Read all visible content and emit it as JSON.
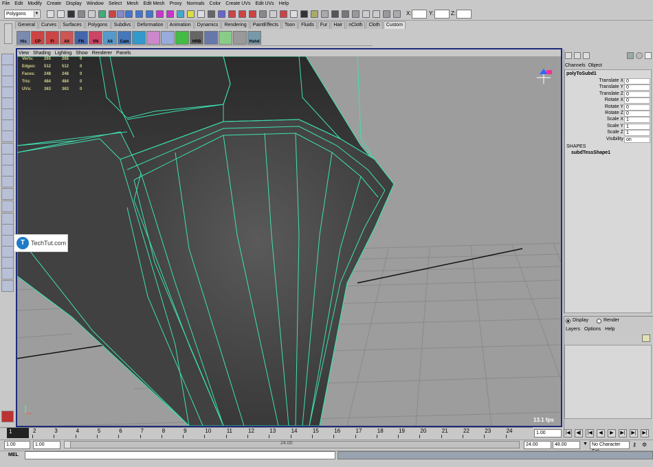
{
  "menubar": [
    "File",
    "Edit",
    "Modify",
    "Create",
    "Display",
    "Window",
    "Select",
    "Mesh",
    "Edit Mesh",
    "Proxy",
    "Normals",
    "Color",
    "Create UVs",
    "Edit UVs",
    "Help"
  ],
  "status_line": {
    "mode": "Polygons",
    "x_label": "X:",
    "y_label": "Y:",
    "z_label": "Z:"
  },
  "shelf_tabs": [
    "General",
    "Curves",
    "Surfaces",
    "Polygons",
    "Subdivs",
    "Deformation",
    "Animation",
    "Dynamics",
    "Rendering",
    "PaintEffects",
    "Toon",
    "Fluids",
    "Fur",
    "Hair",
    "nCloth",
    "Cloth",
    "Custom"
  ],
  "active_shelf_tab": "Custom",
  "shelf_buttons": [
    "His",
    "CP",
    "FI",
    "All",
    "FN",
    "VN",
    "All",
    "Cam",
    "",
    "",
    "",
    "",
    "HRB",
    "",
    "",
    "",
    "Hshd"
  ],
  "viewport_menu": [
    "View",
    "Shading",
    "Lighting",
    "Show",
    "Renderer",
    "Panels"
  ],
  "hud": {
    "rows": [
      {
        "label": "Verts:",
        "a": "265",
        "b": "265",
        "c": "0"
      },
      {
        "label": "Edges:",
        "a": "512",
        "b": "512",
        "c": "0"
      },
      {
        "label": "Faces:",
        "a": "248",
        "b": "248",
        "c": "0"
      },
      {
        "label": "Tris:",
        "a": "484",
        "b": "484",
        "c": "0"
      },
      {
        "label": "UVs:",
        "a": "363",
        "b": "363",
        "c": "0"
      }
    ],
    "fps": "13.1 fps"
  },
  "watermark": {
    "logo": "T",
    "text": "TechTut.com"
  },
  "channel_box": {
    "menu": [
      "Channels",
      "Object"
    ],
    "node": "polyToSubd1",
    "attributes": [
      {
        "name": "Translate X",
        "value": "0"
      },
      {
        "name": "Translate Y",
        "value": "0"
      },
      {
        "name": "Translate Z",
        "value": "0"
      },
      {
        "name": "Rotate X",
        "value": "0"
      },
      {
        "name": "Rotate Y",
        "value": "0"
      },
      {
        "name": "Rotate Z",
        "value": "0"
      },
      {
        "name": "Scale X",
        "value": "1"
      },
      {
        "name": "Scale Y",
        "value": "1"
      },
      {
        "name": "Scale Z",
        "value": "1"
      },
      {
        "name": "Visibility",
        "value": "on"
      }
    ],
    "shapes_label": "SHAPES",
    "shape": "subdTessShape1"
  },
  "layer_editor": {
    "display_label": "Display",
    "render_label": "Render",
    "menu": [
      "Layers",
      "Options",
      "Help"
    ]
  },
  "time_slider": {
    "current_frame": "1",
    "ticks": [
      "2",
      "3",
      "4",
      "5",
      "6",
      "7",
      "8",
      "9",
      "10",
      "11",
      "12",
      "13",
      "14",
      "15",
      "16",
      "17",
      "18",
      "19",
      "20",
      "21",
      "22",
      "23",
      "24"
    ],
    "current_time_field": "1.00"
  },
  "range_slider": {
    "start": "1.00",
    "playback_start": "1.00",
    "range_end_label": "24.00",
    "playback_end": "24.00",
    "end": "48.00",
    "character_set": "No Character Set"
  },
  "command_line": {
    "label": "MEL"
  },
  "colors": {
    "wire": "#3ee2b2",
    "viewport_border": "#1d2a7a",
    "hud_text": "#d6d08a"
  }
}
